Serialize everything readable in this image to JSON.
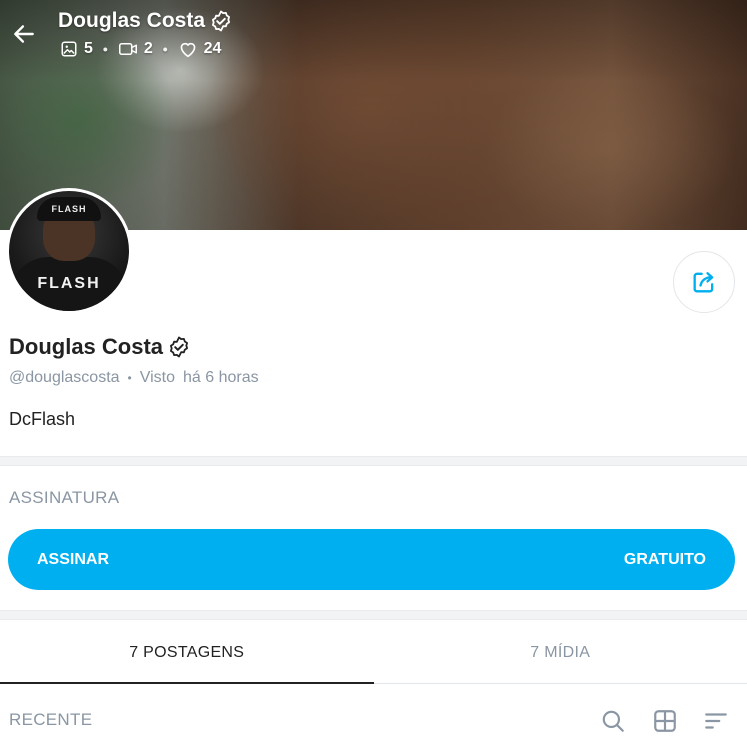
{
  "header": {
    "name": "Douglas Costa",
    "stats": [
      {
        "icon": "image-icon",
        "value": "5"
      },
      {
        "icon": "video-icon",
        "value": "2"
      },
      {
        "icon": "heart-icon",
        "value": "24"
      }
    ]
  },
  "avatar": {
    "cap_text": "FLASH",
    "shirt_text": "FLASH"
  },
  "profile": {
    "name": "Douglas Costa",
    "handle": "@douglascosta",
    "separator": "•",
    "last_seen_label": "Visto",
    "last_seen_time": "há 6 horas",
    "bio": "DcFlash"
  },
  "subscription": {
    "section_title": "ASSINATURA",
    "button_label": "ASSINAR",
    "button_price": "GRATUITO"
  },
  "tabs": [
    {
      "label": "7 POSTAGENS",
      "active": true
    },
    {
      "label": "7 MÍDIA",
      "active": false
    }
  ],
  "toolbar": {
    "recent_label": "RECENTE"
  },
  "colors": {
    "accent": "#00aff0",
    "muted": "#8a96a3",
    "text": "#222222"
  }
}
